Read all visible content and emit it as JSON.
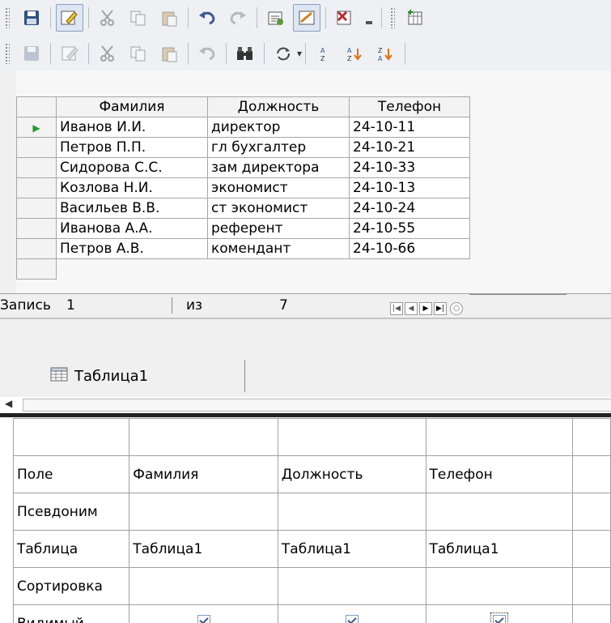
{
  "toolbar1": {
    "icons": [
      "save-icon",
      "edit-mode-icon",
      "cut-icon",
      "copy-icon",
      "paste-icon",
      "undo-icon",
      "redo-icon",
      "run-query-icon",
      "design-view-icon",
      "delete-icon",
      "more-icon",
      "add-table-icon"
    ]
  },
  "toolbar2": {
    "icons": [
      "save-record-icon",
      "edit-icon",
      "cut-icon",
      "copy-icon",
      "paste-icon",
      "undo-icon",
      "find-icon",
      "refresh-icon",
      "sort-icon",
      "sort-asc-icon",
      "sort-desc-icon"
    ]
  },
  "grid": {
    "columns": [
      "Фамилия",
      "Должность",
      "Телефон"
    ],
    "rows": [
      [
        "Иванов И.И.",
        "директор",
        "24-10-11"
      ],
      [
        "Петров П.П.",
        "гл бухгалтер",
        "24-10-21"
      ],
      [
        "Сидорова С.С.",
        "зам директора",
        "24-10-33"
      ],
      [
        "Козлова Н.И.",
        "экономист",
        "24-10-13"
      ],
      [
        "Васильев В.В.",
        "ст экономист",
        "24-10-24"
      ],
      [
        "Иванова А.А.",
        "референт",
        "24-10-55"
      ],
      [
        "Петров А.В.",
        "комендант",
        "24-10-66"
      ]
    ]
  },
  "nav": {
    "record_label": "Запись",
    "record_value": "1",
    "of_label": "из",
    "total": "7"
  },
  "table_tab": {
    "label": "Таблица1"
  },
  "design": {
    "row_labels": [
      "Поле",
      "Псевдоним",
      "Таблица",
      "Сортировка",
      "Видимый"
    ],
    "fields": [
      "Фамилия",
      "Должность",
      "Телефон"
    ],
    "tables": [
      "Таблица1",
      "Таблица1",
      "Таблица1"
    ],
    "visible": [
      true,
      true,
      true
    ]
  }
}
